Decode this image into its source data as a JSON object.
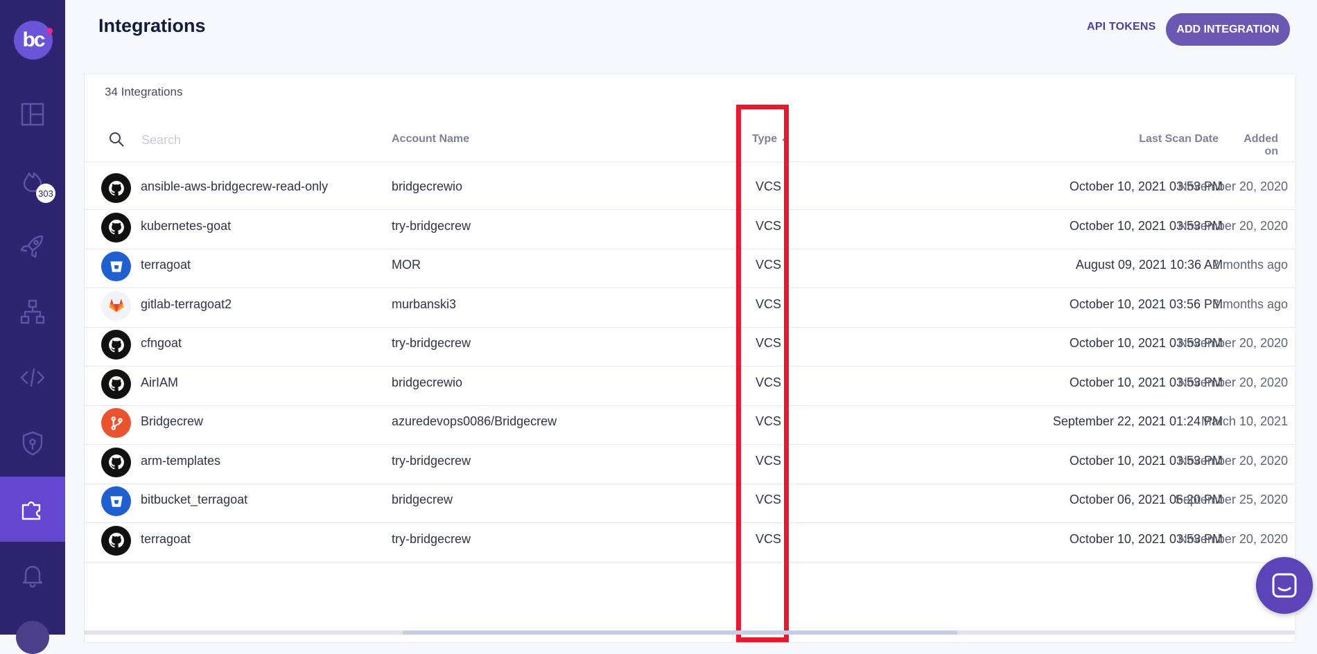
{
  "sidebar": {
    "logo_text": "bc",
    "items": [
      {
        "icon": "dashboard-grid-icon"
      },
      {
        "icon": "flame-icon",
        "badge": "303"
      },
      {
        "icon": "rocket-icon"
      },
      {
        "icon": "hierarchy-icon"
      },
      {
        "icon": "code-icon"
      },
      {
        "icon": "shield-icon"
      },
      {
        "icon": "puzzle-icon",
        "active": true
      },
      {
        "icon": "bell-icon"
      }
    ]
  },
  "header": {
    "title": "Integrations",
    "api_tokens_label": "API TOKENS",
    "add_integration_label": "ADD INTEGRATION"
  },
  "table": {
    "count_label": "34 Integrations",
    "search_placeholder": "Search",
    "columns": {
      "account_name": "Account Name",
      "type": "Type",
      "last_scan_date": "Last Scan Date",
      "added_on": "Added on"
    },
    "sort": {
      "column": "type",
      "direction": "ascending"
    },
    "rows": [
      {
        "provider": "github",
        "name": "ansible-aws-bridgecrew-read-only",
        "account": "bridgecrewio",
        "type": "VCS",
        "last_scan": "October 10, 2021 03:53 PM",
        "added": "November 20, 2020"
      },
      {
        "provider": "github",
        "name": "kubernetes-goat",
        "account": "try-bridgecrew",
        "type": "VCS",
        "last_scan": "October 10, 2021 03:53 PM",
        "added": "November 20, 2020"
      },
      {
        "provider": "bitbucket",
        "name": "terragoat",
        "account": "MOR",
        "type": "VCS",
        "last_scan": "August 09, 2021 10:36 AM",
        "added": "2 months ago"
      },
      {
        "provider": "gitlab",
        "name": "gitlab-terragoat2",
        "account": "murbanski3",
        "type": "VCS",
        "last_scan": "October 10, 2021 03:56 PM",
        "added": "3 months ago"
      },
      {
        "provider": "github",
        "name": "cfngoat",
        "account": "try-bridgecrew",
        "type": "VCS",
        "last_scan": "October 10, 2021 03:53 PM",
        "added": "November 20, 2020"
      },
      {
        "provider": "github",
        "name": "AirIAM",
        "account": "bridgecrewio",
        "type": "VCS",
        "last_scan": "October 10, 2021 03:53 PM",
        "added": "November 20, 2020"
      },
      {
        "provider": "azure",
        "name": "Bridgecrew",
        "account": "azuredevops0086/Bridgecrew",
        "type": "VCS",
        "last_scan": "September 22, 2021 01:24 PM",
        "added": "March 10, 2021"
      },
      {
        "provider": "github",
        "name": "arm-templates",
        "account": "try-bridgecrew",
        "type": "VCS",
        "last_scan": "October 10, 2021 03:53 PM",
        "added": "November 20, 2020"
      },
      {
        "provider": "bitbucket",
        "name": "bitbucket_terragoat",
        "account": "bridgecrew",
        "type": "VCS",
        "last_scan": "October 06, 2021 06:20 PM",
        "added": "September 25, 2020"
      },
      {
        "provider": "github",
        "name": "terragoat",
        "account": "try-bridgecrew",
        "type": "VCS",
        "last_scan": "October 10, 2021 03:53 PM",
        "added": "November 20, 2020"
      }
    ]
  },
  "colors": {
    "sidebar_bg": "#2f2470",
    "accent": "#6b58b3",
    "active_nav": "#6447d0",
    "highlight": "#e8192c"
  }
}
